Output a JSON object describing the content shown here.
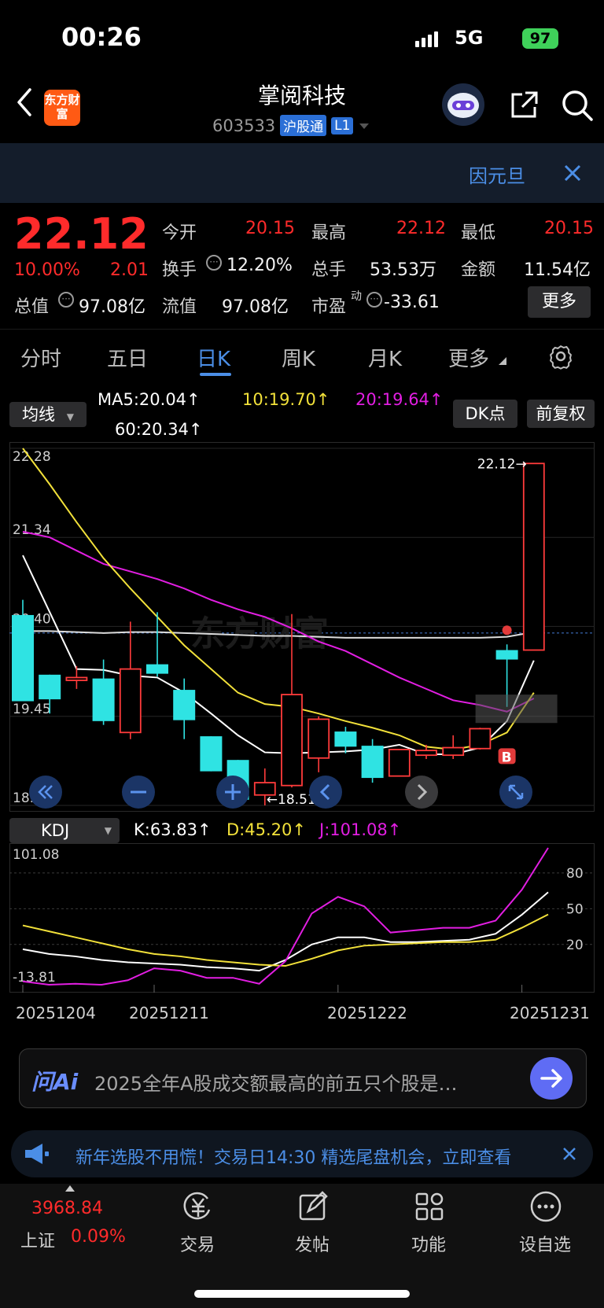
{
  "status": {
    "time": "00:26",
    "network": "5G",
    "battery": "97"
  },
  "header": {
    "logo_text": "东方财富",
    "title": "掌阅科技",
    "code": "603533",
    "tag1": "沪股通",
    "tag2": "L1"
  },
  "banner": {
    "text": "因元旦"
  },
  "quote": {
    "price": "22.12",
    "change_pct": "10.00%",
    "change": "2.01",
    "open_label": "今开",
    "open": "20.15",
    "high_label": "最高",
    "high": "22.12",
    "low_label": "最低",
    "low": "20.15",
    "turnover_label": "换手",
    "turnover": "12.20%",
    "volume_label": "总手",
    "volume": "53.53万",
    "amount_label": "金额",
    "amount": "11.54亿",
    "mktcap_label": "总值",
    "mktcap": "97.08亿",
    "float_label": "流值",
    "float": "97.08亿",
    "pe_label": "市盈",
    "pe_sup": "动",
    "pe": "-33.61",
    "more": "更多"
  },
  "tabs": [
    "分时",
    "五日",
    "日K",
    "周K",
    "月K",
    "更多"
  ],
  "active_tab": "日K",
  "ma": {
    "selector": "均线",
    "ma5": "MA5:20.04↑",
    "ma10": "10:19.70↑",
    "ma20": "20:19.64↑",
    "ma60": "60:20.34↑",
    "dk": "DK点",
    "adjust": "前复权",
    "colors": {
      "ma5": "#ffffff",
      "ma10": "#f2e13a",
      "ma20": "#e21ee2",
      "ma60": "#dcdcdc"
    }
  },
  "chart_data": [
    {
      "type": "candlestick",
      "y_ticks": [
        "22.28",
        "21.34",
        "20.40",
        "19.45",
        "18.51"
      ],
      "ylim": [
        18.51,
        22.28
      ],
      "annotation_high": "22.12",
      "annotation_low": "18.51",
      "marker": "B",
      "candles": [
        {
          "o": 20.52,
          "c": 19.61,
          "h": 20.68,
          "l": 19.61,
          "up": false
        },
        {
          "o": 19.89,
          "c": 19.63,
          "h": 19.89,
          "l": 19.48,
          "up": false
        },
        {
          "o": 19.83,
          "c": 19.86,
          "h": 19.98,
          "l": 19.74,
          "up": true
        },
        {
          "o": 19.85,
          "c": 19.4,
          "h": 20.05,
          "l": 19.36,
          "up": false
        },
        {
          "o": 19.28,
          "c": 19.95,
          "h": 20.45,
          "l": 19.21,
          "up": true
        },
        {
          "o": 20.0,
          "c": 19.9,
          "h": 20.55,
          "l": 19.87,
          "up": false
        },
        {
          "o": 19.73,
          "c": 19.41,
          "h": 19.85,
          "l": 19.21,
          "up": false
        },
        {
          "o": 19.24,
          "c": 18.87,
          "h": 19.24,
          "l": 18.87,
          "up": false
        },
        {
          "o": 18.99,
          "c": 18.57,
          "h": 18.99,
          "l": 18.57,
          "up": false
        },
        {
          "o": 18.62,
          "c": 18.75,
          "h": 18.9,
          "l": 18.51,
          "up": true
        },
        {
          "o": 18.72,
          "c": 19.68,
          "h": 20.53,
          "l": 18.7,
          "up": true
        },
        {
          "o": 19.01,
          "c": 19.42,
          "h": 19.45,
          "l": 18.86,
          "up": true
        },
        {
          "o": 19.29,
          "c": 19.13,
          "h": 19.34,
          "l": 19.06,
          "up": false
        },
        {
          "o": 19.14,
          "c": 18.8,
          "h": 19.21,
          "l": 18.75,
          "up": false
        },
        {
          "o": 18.82,
          "c": 19.1,
          "h": 19.1,
          "l": 18.82,
          "up": true
        },
        {
          "o": 19.04,
          "c": 19.09,
          "h": 19.15,
          "l": 19.0,
          "up": true
        },
        {
          "o": 19.04,
          "c": 19.12,
          "h": 19.25,
          "l": 19.0,
          "up": true
        },
        {
          "o": 19.11,
          "c": 19.32,
          "h": 19.33,
          "l": 19.1,
          "up": true
        },
        {
          "o": 20.15,
          "c": 20.05,
          "h": 20.21,
          "l": 19.55,
          "up": false
        },
        {
          "o": 20.15,
          "c": 22.12,
          "h": 22.12,
          "l": 20.15,
          "up": true
        }
      ],
      "ma_series": {
        "ma5": [
          21.15,
          20.55,
          19.95,
          19.94,
          19.88,
          19.86,
          19.7,
          19.48,
          19.25,
          19.07,
          19.06,
          19.07,
          19.08,
          19.1,
          19.15,
          19.05,
          19.05,
          19.12,
          19.4,
          20.04
        ],
        "ma10": [
          22.28,
          21.9,
          21.5,
          21.12,
          20.8,
          20.5,
          20.2,
          19.95,
          19.7,
          19.58,
          19.55,
          19.48,
          19.4,
          19.33,
          19.25,
          19.13,
          19.1,
          19.15,
          19.28,
          19.7
        ],
        "ma20": [
          21.4,
          21.34,
          21.2,
          21.06,
          20.98,
          20.9,
          20.8,
          20.68,
          20.58,
          20.5,
          20.38,
          20.24,
          20.14,
          20.0,
          19.86,
          19.74,
          19.62,
          19.57,
          19.5,
          19.64
        ],
        "ma60": [
          20.35,
          20.35,
          20.34,
          20.33,
          20.34,
          20.34,
          20.33,
          20.32,
          20.31,
          20.3,
          20.3,
          20.29,
          20.28,
          20.28,
          20.28,
          20.28,
          20.28,
          20.28,
          20.29,
          20.34
        ]
      }
    },
    {
      "type": "line",
      "title": "KDJ",
      "k_label": "K:63.83↑",
      "d_label": "D:45.20↑",
      "j_label": "J:101.08↑",
      "y_ticks_left": [
        "101.08",
        "-13.81"
      ],
      "y_ticks_right": [
        "80",
        "50",
        "20"
      ],
      "ylim": [
        -13.81,
        101.08
      ],
      "x_labels": [
        "20251204",
        "20251211",
        "20251222",
        "20251231"
      ],
      "series": [
        {
          "name": "K",
          "color": "#ffffff",
          "values": [
            16,
            12,
            10,
            7,
            5,
            4,
            3,
            1,
            0,
            -2,
            7,
            20,
            26,
            26,
            22,
            22,
            23,
            24,
            29,
            45,
            63.83
          ]
        },
        {
          "name": "D",
          "color": "#f2e13a",
          "values": [
            36,
            31,
            26,
            21,
            16,
            12,
            10,
            7,
            5,
            3,
            2,
            8,
            15,
            19,
            20,
            21,
            22,
            22,
            24,
            34,
            45.2
          ]
        },
        {
          "name": "J",
          "color": "#e21ee2",
          "values": [
            -11,
            -13.81,
            -13,
            -14,
            -10,
            0,
            -2,
            -8,
            -8,
            -13,
            6,
            46,
            60,
            52,
            30,
            32,
            34,
            34,
            40,
            66,
            101.08
          ]
        }
      ]
    }
  ],
  "ai": {
    "brand": "问Ai",
    "prompt": "2025全年A股成交额最高的前五只个股是…"
  },
  "notice": {
    "text": "新年选股不用慌！交易日14:30 精选尾盘机会，立即查看"
  },
  "bottom_nav": {
    "index_value": "3968.84",
    "index_name": "上证",
    "index_change": "0.09%",
    "items": [
      "交易",
      "发帖",
      "功能",
      "设自选"
    ]
  }
}
